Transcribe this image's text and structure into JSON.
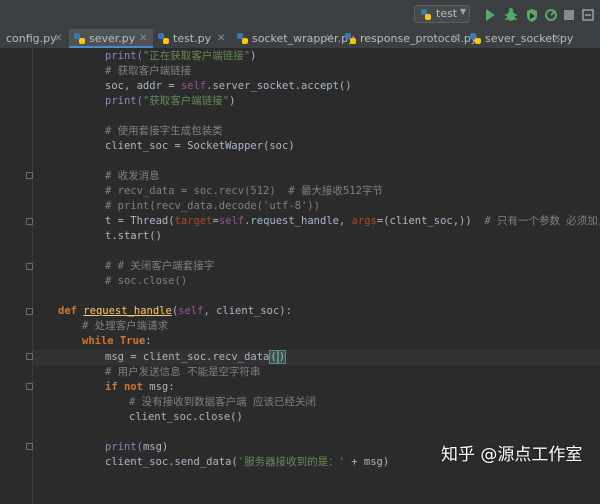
{
  "toolbar": {
    "run_config": "test",
    "buttons": [
      "run-icon",
      "debug-icon",
      "coverage-icon",
      "profile-icon",
      "stop-icon",
      "settings-icon"
    ]
  },
  "tabs": [
    {
      "label": "config.py",
      "active": false
    },
    {
      "label": "sever.py",
      "active": true
    },
    {
      "label": "test.py",
      "active": false
    },
    {
      "label": "socket_wrapper.py",
      "active": false
    },
    {
      "label": "response_protocol.py",
      "active": false
    },
    {
      "label": "sever_socket.py",
      "active": false
    }
  ],
  "code": {
    "l01": [
      "print(",
      "\"正在获取客户端链接\"",
      ")"
    ],
    "l02": "# 获取客户端链接",
    "l03": [
      "soc, addr = ",
      "self",
      ".server_socket.accept()"
    ],
    "l04": [
      "print(",
      "\"获取客户端链接\"",
      ")"
    ],
    "l05": "# 使用套接字生成包装类",
    "l06": "client_soc = SocketWapper(soc)",
    "l07": "# 收发消息",
    "l08": "# recv_data = soc.recv(512)  # 最大接收512字节",
    "l09": "# print(recv_data.decode('utf-8'))",
    "l10": [
      "t = Thread(",
      "target",
      "=",
      "self",
      ".request_handle, ",
      "args",
      "=(client_soc,))  ",
      "# 只有一个参数 必须加，"
    ],
    "l11": "t.start()",
    "l12": "# # 关闭客户端套接字",
    "l13": "# soc.close()",
    "l14": [
      "def ",
      "request_handle",
      "(",
      "self",
      ", client_soc):"
    ],
    "l15": "# 处理客户端请求",
    "l16": [
      "while ",
      "True",
      ":"
    ],
    "l17": [
      "msg = client_soc.recv_data",
      "(",
      ")"
    ],
    "l18": "# 用户发送信息 不能是空字符串",
    "l19": [
      "if not ",
      "msg:"
    ],
    "l20": "# 没有接收到数据客户端 应该已经关闭",
    "l21": "client_soc.close()",
    "l22": [
      "print(",
      "msg)"
    ],
    "l23": [
      "client_soc.send_data(",
      "'服务器接收到的是：'",
      " + msg)"
    ]
  },
  "watermark": "知乎 @源点工作室"
}
